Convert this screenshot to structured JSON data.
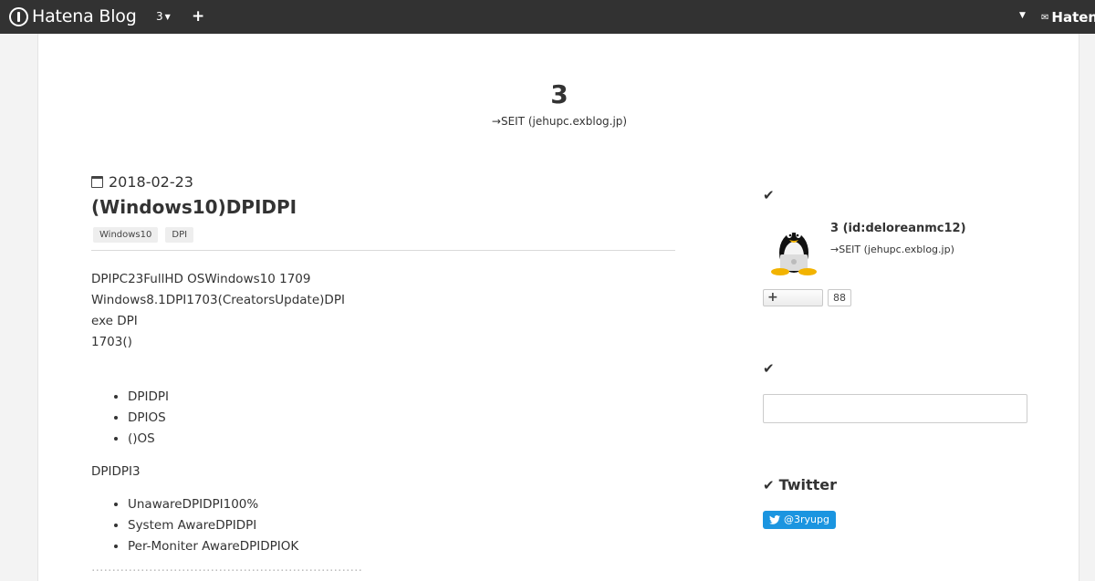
{
  "topbar": {
    "logo_text": "Hatena Blog",
    "blog_menu": "3",
    "add_icon": "plus-icon",
    "right_brand_text": "Haten"
  },
  "blog": {
    "title": "3",
    "description": "→SEIT (jehupc.exblog.jp)"
  },
  "entry": {
    "date": "2018-02-23",
    "title": "(Windows10)DPIDPI",
    "categories": [
      "Windows10",
      "DPI"
    ],
    "paragraph_lines": [
      "DPIPC23FullHD OSWindows10 1709",
      "Windows8.1DPI1703(CreatorsUpdate)DPI",
      "exe DPI",
      "1703()"
    ],
    "list1": [
      "DPIDPI",
      "DPIOS",
      "()OS"
    ],
    "paragraph2": "DPIDPI3",
    "list2": [
      "UnawareDPIDPI100%",
      "System AwareDPIDPI",
      "Per-Moniter AwareDPIDPIOK"
    ],
    "faded_line": "…………………………………………………………"
  },
  "sidebar": {
    "profile": {
      "header_icon": "check-icon",
      "name": "3 (id:deloreanmc12)",
      "description": "→SEIT (jehupc.exblog.jp)",
      "follow_label": "+",
      "follower_count": "88"
    },
    "search": {
      "header_icon": "check-icon",
      "placeholder": ""
    },
    "twitter": {
      "header_icon": "check-icon",
      "title": "Twitter",
      "button_label": "@3ryupg"
    }
  }
}
